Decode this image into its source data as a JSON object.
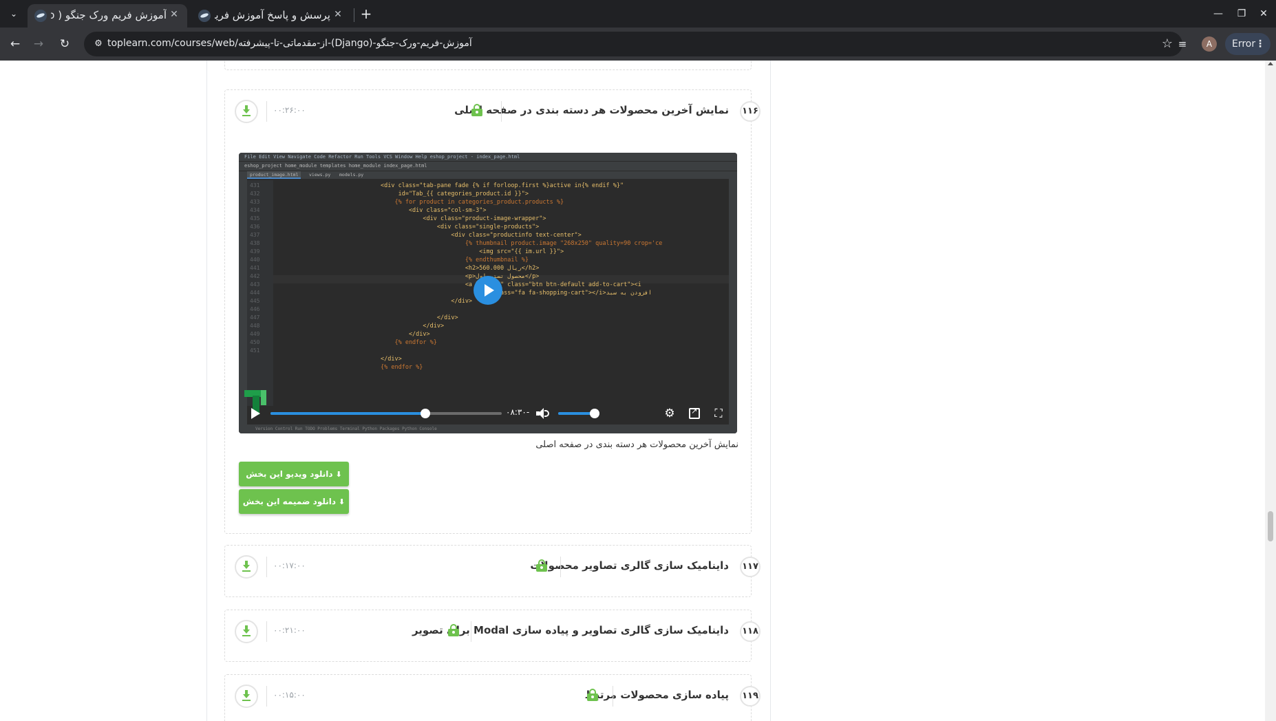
{
  "browser": {
    "tabs": [
      {
        "title": "آموزش فریم ورک جنگو ( Django",
        "active": true
      },
      {
        "title": "پرسش و پاسخ آموزش فریم",
        "active": false
      }
    ],
    "url": "toplearn.com/courses/web/از-مقدماتی-تا-پیشرفته-(Django)-آموزش-فریم-ورک-جنگو",
    "profile_initial": "A",
    "error_label": "Error"
  },
  "lessons": [
    {
      "number": "۱۱۶",
      "title": "نمایش آخرین محصولات هر دسته بندی در صفحه اصلی",
      "duration": "۰۰:۲۶:۰۰",
      "expanded": true,
      "caption": "نمایش آخرین محصولات هر دسته بندی در صفحه اصلی",
      "download_video_label": "دانلود ویدیو این بخش",
      "download_attachment_label": "دانلود ضمیمه این بخش"
    },
    {
      "number": "۱۱۷",
      "title": "داینامیک سازی گالری تصاویر محصولات",
      "duration": "۰۰:۱۷:۰۰"
    },
    {
      "number": "۱۱۸",
      "title": "داینامیک سازی گالری تصاویر و پیاده سازی Modal برای تصویر",
      "duration": "۰۰:۲۱:۰۰"
    },
    {
      "number": "۱۱۹",
      "title": "پیاده سازی محصولات مرتبط",
      "duration": "۰۰:۱۵:۰۰"
    }
  ],
  "player": {
    "time_remaining": "-۰۸:۳۰",
    "progress_fraction": 0.67,
    "volume_fraction": 0.88,
    "accent_color": "#2a8fe0",
    "ide": {
      "menu": "File  Edit  View  Navigate  Code  Refactor  Run  Tools  VCS  Window  Help        eshop_project - index_page.html",
      "path": "eshop_project  home_module  templates  home_module  index_page.html",
      "run_config": "eshop_project",
      "tabs": [
        "product_image.html",
        "views.py",
        "models.py"
      ],
      "line_numbers": [
        "431",
        "432",
        "433",
        "434",
        "435",
        "436",
        "437",
        "438",
        "439",
        "440",
        "441",
        "442",
        "443",
        "444",
        "445",
        "446",
        "447",
        "448",
        "449",
        "450",
        "451"
      ],
      "code_lines": [
        "<div class=\"tab-pane fade {% if forloop.first %}active in{% endif %}\"",
        "     id=\"Tab_{{ categories_product.id }}\">",
        "    {% for product in categories_product.products %}",
        "        <div class=\"col-sm-3\">",
        "            <div class=\"product-image-wrapper\">",
        "                <div class=\"single-products\">",
        "                    <div class=\"productinfo text-center\">",
        "                        {% thumbnail product.image \"268x250\" quality=90 crop='ce",
        "                            <img src=\"{{ im.url }}\">",
        "                        {% endthumbnail %}",
        "                        <h2>ریال 560.000</h2>",
        "                        <p>محصول تستی اول</p>",
        "                        <a href=\"#\" class=\"btn btn-default add-to-cart\"><i",
        "                                class=\"fa fa-shopping-cart\"></i>افزودن به سبد",
        "                    </div>",
        "",
        "                </div>",
        "            </div>",
        "        </div>",
        "    {% endfor %}",
        "",
        "</div>",
        "{% endfor %}"
      ],
      "status": "Version Control   Run   TODO   Problems   Terminal   Python Packages   Python Console"
    }
  },
  "colors": {
    "accent_green": "#6ec24e",
    "chrome_dark": "#202124",
    "chrome_toolbar": "#35363a"
  }
}
